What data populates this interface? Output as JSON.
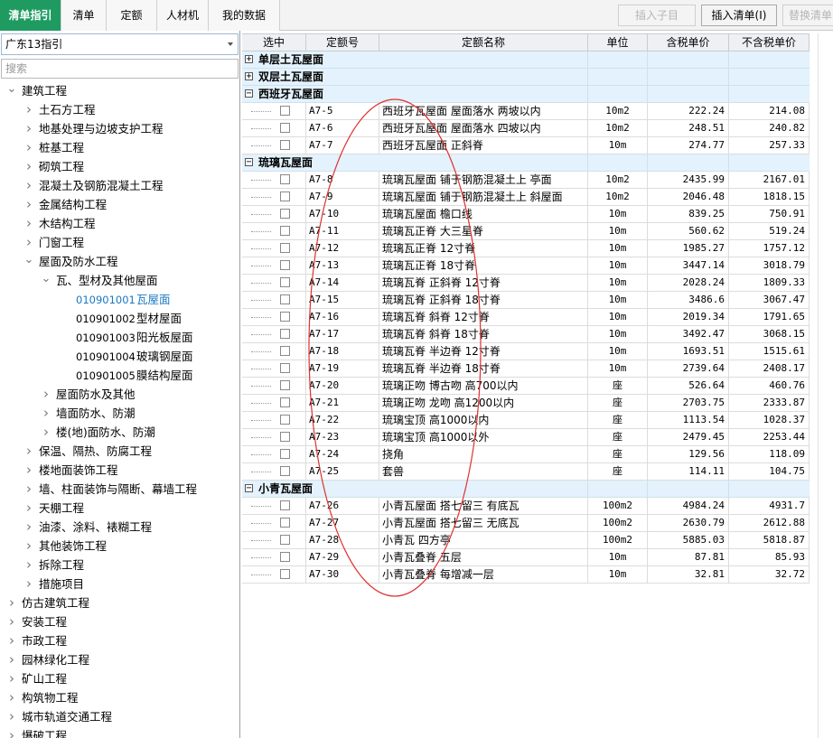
{
  "tabs": [
    {
      "label": "清单指引",
      "active": true
    },
    {
      "label": "清单",
      "active": false
    },
    {
      "label": "定额",
      "active": false
    },
    {
      "label": "人材机",
      "active": false
    },
    {
      "label": "我的数据",
      "active": false
    }
  ],
  "toolbar": {
    "insert_child": "插入子目",
    "insert_list": "插入清单(I)",
    "replace_list": "替换清单"
  },
  "left": {
    "combo_value": "广东13指引",
    "search_placeholder": "搜索"
  },
  "tree": [
    {
      "label": "建筑工程",
      "expanded": true
    },
    {
      "label": "土石方工程"
    },
    {
      "label": "地基处理与边坡支护工程"
    },
    {
      "label": "桩基工程"
    },
    {
      "label": "砌筑工程"
    },
    {
      "label": "混凝土及钢筋混凝土工程"
    },
    {
      "label": "金属结构工程"
    },
    {
      "label": "木结构工程"
    },
    {
      "label": "门窗工程"
    },
    {
      "label": "屋面及防水工程",
      "expanded": true
    },
    {
      "label": "瓦、型材及其他屋面",
      "expanded": true
    },
    {
      "code": "010901001",
      "label": "瓦屋面",
      "selected": true
    },
    {
      "code": "010901002",
      "label": "型材屋面"
    },
    {
      "code": "010901003",
      "label": "阳光板屋面"
    },
    {
      "code": "010901004",
      "label": "玻璃钢屋面"
    },
    {
      "code": "010901005",
      "label": "膜结构屋面"
    },
    {
      "label": "屋面防水及其他"
    },
    {
      "label": "墙面防水、防潮"
    },
    {
      "label": "楼(地)面防水、防潮"
    },
    {
      "label": "保温、隔热、防腐工程"
    },
    {
      "label": "楼地面装饰工程"
    },
    {
      "label": "墙、柱面装饰与隔断、幕墙工程"
    },
    {
      "label": "天棚工程"
    },
    {
      "label": "油漆、涂料、裱糊工程"
    },
    {
      "label": "其他装饰工程"
    },
    {
      "label": "拆除工程"
    },
    {
      "label": "措施项目"
    },
    {
      "label": "仿古建筑工程"
    },
    {
      "label": "安装工程"
    },
    {
      "label": "市政工程"
    },
    {
      "label": "园林绿化工程"
    },
    {
      "label": "矿山工程"
    },
    {
      "label": "构筑物工程"
    },
    {
      "label": "城市轨道交通工程"
    },
    {
      "label": "爆破工程"
    }
  ],
  "grid": {
    "headers": [
      "选中",
      "定额号",
      "定额名称",
      "单位",
      "含税单价",
      "不含税单价"
    ],
    "groups": [
      {
        "title": "单层土瓦屋面",
        "expanded": false,
        "rows": []
      },
      {
        "title": "双层土瓦屋面",
        "expanded": false,
        "rows": []
      },
      {
        "title": "西班牙瓦屋面",
        "expanded": true,
        "rows": [
          {
            "code": "A7-5",
            "name": "西班牙瓦屋面 屋面落水 两坡以内",
            "unit": "10m2",
            "tax": "222.24",
            "notax": "214.08"
          },
          {
            "code": "A7-6",
            "name": "西班牙瓦屋面 屋面落水 四坡以内",
            "unit": "10m2",
            "tax": "248.51",
            "notax": "240.82"
          },
          {
            "code": "A7-7",
            "name": "西班牙瓦屋面 正斜脊",
            "unit": "10m",
            "tax": "274.77",
            "notax": "257.33"
          }
        ]
      },
      {
        "title": "琉璃瓦屋面",
        "expanded": true,
        "rows": [
          {
            "code": "A7-8",
            "name": "琉璃瓦屋面 铺于钢筋混凝土上 亭面",
            "unit": "10m2",
            "tax": "2435.99",
            "notax": "2167.01"
          },
          {
            "code": "A7-9",
            "name": "琉璃瓦屋面 铺于钢筋混凝土上 斜屋面",
            "unit": "10m2",
            "tax": "2046.48",
            "notax": "1818.15"
          },
          {
            "code": "A7-10",
            "name": "琉璃瓦屋面 檐口线",
            "unit": "10m",
            "tax": "839.25",
            "notax": "750.91"
          },
          {
            "code": "A7-11",
            "name": "琉璃瓦正脊 大三星脊",
            "unit": "10m",
            "tax": "560.62",
            "notax": "519.24"
          },
          {
            "code": "A7-12",
            "name": "琉璃瓦正脊 12寸脊",
            "unit": "10m",
            "tax": "1985.27",
            "notax": "1757.12"
          },
          {
            "code": "A7-13",
            "name": "琉璃瓦正脊 18寸脊",
            "unit": "10m",
            "tax": "3447.14",
            "notax": "3018.79"
          },
          {
            "code": "A7-14",
            "name": "琉璃瓦脊 正斜脊 12寸脊",
            "unit": "10m",
            "tax": "2028.24",
            "notax": "1809.33"
          },
          {
            "code": "A7-15",
            "name": "琉璃瓦脊 正斜脊 18寸脊",
            "unit": "10m",
            "tax": "3486.6",
            "notax": "3067.47"
          },
          {
            "code": "A7-16",
            "name": "琉璃瓦脊 斜脊 12寸脊",
            "unit": "10m",
            "tax": "2019.34",
            "notax": "1791.65"
          },
          {
            "code": "A7-17",
            "name": "琉璃瓦脊 斜脊 18寸脊",
            "unit": "10m",
            "tax": "3492.47",
            "notax": "3068.15"
          },
          {
            "code": "A7-18",
            "name": "琉璃瓦脊 半边脊 12寸脊",
            "unit": "10m",
            "tax": "1693.51",
            "notax": "1515.61"
          },
          {
            "code": "A7-19",
            "name": "琉璃瓦脊 半边脊 18寸脊",
            "unit": "10m",
            "tax": "2739.64",
            "notax": "2408.17"
          },
          {
            "code": "A7-20",
            "name": "琉璃正吻 博古吻 高700以内",
            "unit": "座",
            "tax": "526.64",
            "notax": "460.76"
          },
          {
            "code": "A7-21",
            "name": "琉璃正吻 龙吻 高1200以内",
            "unit": "座",
            "tax": "2703.75",
            "notax": "2333.87"
          },
          {
            "code": "A7-22",
            "name": "琉璃宝顶 高1000以内",
            "unit": "座",
            "tax": "1113.54",
            "notax": "1028.37"
          },
          {
            "code": "A7-23",
            "name": "琉璃宝顶 高1000以外",
            "unit": "座",
            "tax": "2479.45",
            "notax": "2253.44"
          },
          {
            "code": "A7-24",
            "name": "挠角",
            "unit": "座",
            "tax": "129.56",
            "notax": "118.09"
          },
          {
            "code": "A7-25",
            "name": "套兽",
            "unit": "座",
            "tax": "114.11",
            "notax": "104.75"
          }
        ]
      },
      {
        "title": "小青瓦屋面",
        "expanded": true,
        "rows": [
          {
            "code": "A7-26",
            "name": "小青瓦屋面 搭七留三 有底瓦",
            "unit": "100m2",
            "tax": "4984.24",
            "notax": "4931.7"
          },
          {
            "code": "A7-27",
            "name": "小青瓦屋面 搭七留三 无底瓦",
            "unit": "100m2",
            "tax": "2630.79",
            "notax": "2612.88"
          },
          {
            "code": "A7-28",
            "name": "小青瓦 四方亭",
            "unit": "100m2",
            "tax": "5885.03",
            "notax": "5818.87"
          },
          {
            "code": "A7-29",
            "name": "小青瓦叠脊 五层",
            "unit": "10m",
            "tax": "87.81",
            "notax": "85.93"
          },
          {
            "code": "A7-30",
            "name": "小青瓦叠脊 每增减一层",
            "unit": "10m",
            "tax": "32.81",
            "notax": "32.72"
          }
        ]
      }
    ]
  },
  "colors": {
    "accent": "#1f9b61",
    "group_bg": "#e3f2fc",
    "annotation": "#e0312f",
    "selected_text": "#1a78c2"
  }
}
